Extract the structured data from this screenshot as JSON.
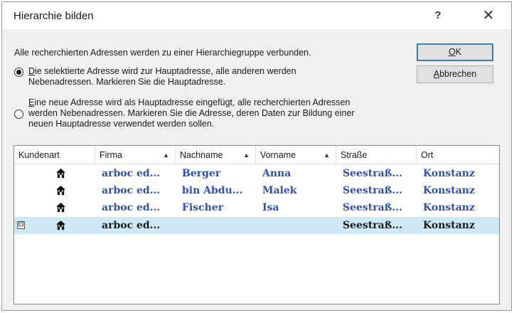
{
  "dialog": {
    "title": "Hierarchie bilden",
    "help_label": "?",
    "close_label": "✕"
  },
  "intro": "Alle recherchierten Adressen werden zu einer Hierarchiegruppe verbunden.",
  "options": [
    {
      "lines": [
        "Die selektierte Adresse wird zur Hauptadresse, alle anderen werden",
        "Nebenadressen. Markieren Sie die Hauptadresse."
      ],
      "checked": true
    },
    {
      "lines": [
        "Eine neue Adresse wird als Hauptadresse eingefügt, alle recherchierten Adressen",
        "werden Nebenadressen. Markieren Sie die Adresse, deren Daten zur Bildung einer",
        "neuen Hauptadresse verwendet werden sollen."
      ],
      "checked": false
    }
  ],
  "buttons": {
    "ok": "OK",
    "cancel": "Abbrechen"
  },
  "table": {
    "columns": [
      "Kundenart",
      "Firma",
      "Nachname",
      "Vorname",
      "Straße",
      "Ort"
    ],
    "sort_arrow": "▲",
    "expand_label": "⊟",
    "rows": [
      {
        "kundenart_icon": "house-icon",
        "firma": "arboc ed...",
        "nachname": "Berger",
        "vorname": "Anna",
        "strasse": "Seestraß...",
        "ort": "Konstanz"
      },
      {
        "kundenart_icon": "house-icon",
        "firma": "arboc ed...",
        "nachname": "bin Abdu...",
        "vorname": "Malek",
        "strasse": "Seestraß...",
        "ort": "Konstanz"
      },
      {
        "kundenart_icon": "house-icon",
        "firma": "arboc ed...",
        "nachname": "Fischer",
        "vorname": "Isa",
        "strasse": "Seestraß...",
        "ort": "Konstanz"
      },
      {
        "kundenart_icon": "house-icon",
        "firma": "arboc ed...",
        "nachname": "",
        "vorname": "",
        "strasse": "Seestraß...",
        "ort": "Konstanz",
        "selected": true
      }
    ]
  },
  "colors": {
    "link_text": "#2c4fb8",
    "selected_row": "#cde8f7",
    "default_button_border": "#3c7fb1"
  }
}
